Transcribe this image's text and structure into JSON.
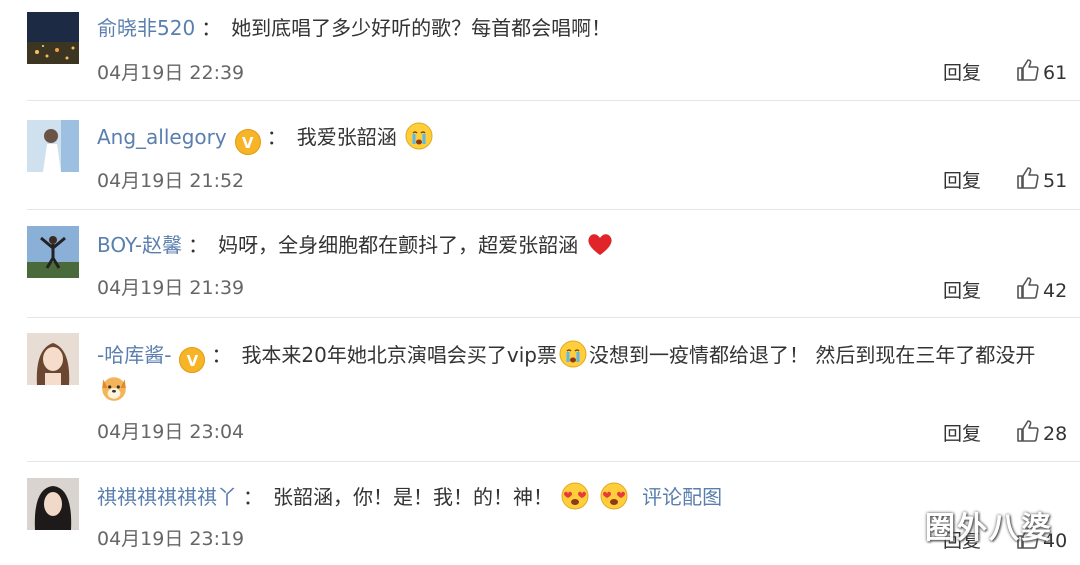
{
  "comments": [
    {
      "user": "俞晓非520",
      "colon": "：",
      "text": "她到底唱了多少好听的歌？每首都会唱啊！",
      "time": "04月19日 22:39",
      "reply": "回复",
      "likes": "61"
    },
    {
      "user": "Ang_allegory",
      "colon": "：",
      "text": "我爱张韶涵",
      "time": "04月19日 21:52",
      "reply": "回复",
      "likes": "51",
      "emoji": "crying-face-icon"
    },
    {
      "user": "BOY-赵馨",
      "colon": "：",
      "text": "妈呀，全身细胞都在颤抖了，超爱张韶涵",
      "time": "04月19日 21:39",
      "reply": "回复",
      "likes": "42",
      "emoji": "red-heart-icon"
    },
    {
      "user": "-哈库酱-",
      "colon": "：",
      "text": "我本来20年她北京演唱会买了vip票",
      "text2": "没想到一疫情都给退了！ 然后到现在三年了都没开",
      "time": "04月19日 23:04",
      "reply": "回复",
      "likes": "28",
      "emoji": "crying-face-icon",
      "emoji2": "dog-face-icon"
    },
    {
      "user": "祺祺祺祺祺祺丫",
      "colon": "：",
      "text": "张韶涵，你！是！我！的！神！",
      "link": "评论配图",
      "time": "04月19日 23:19",
      "reply": "回复",
      "likes": "40",
      "emoji": "heart-eyes-face-icon"
    }
  ],
  "badge_letter": "V",
  "watermark": "圈外八婆",
  "colors": {
    "username": "#5a7fae",
    "text": "#333333",
    "time": "#666666",
    "badge": "#f6b426",
    "divider": "#e6e6e6"
  }
}
